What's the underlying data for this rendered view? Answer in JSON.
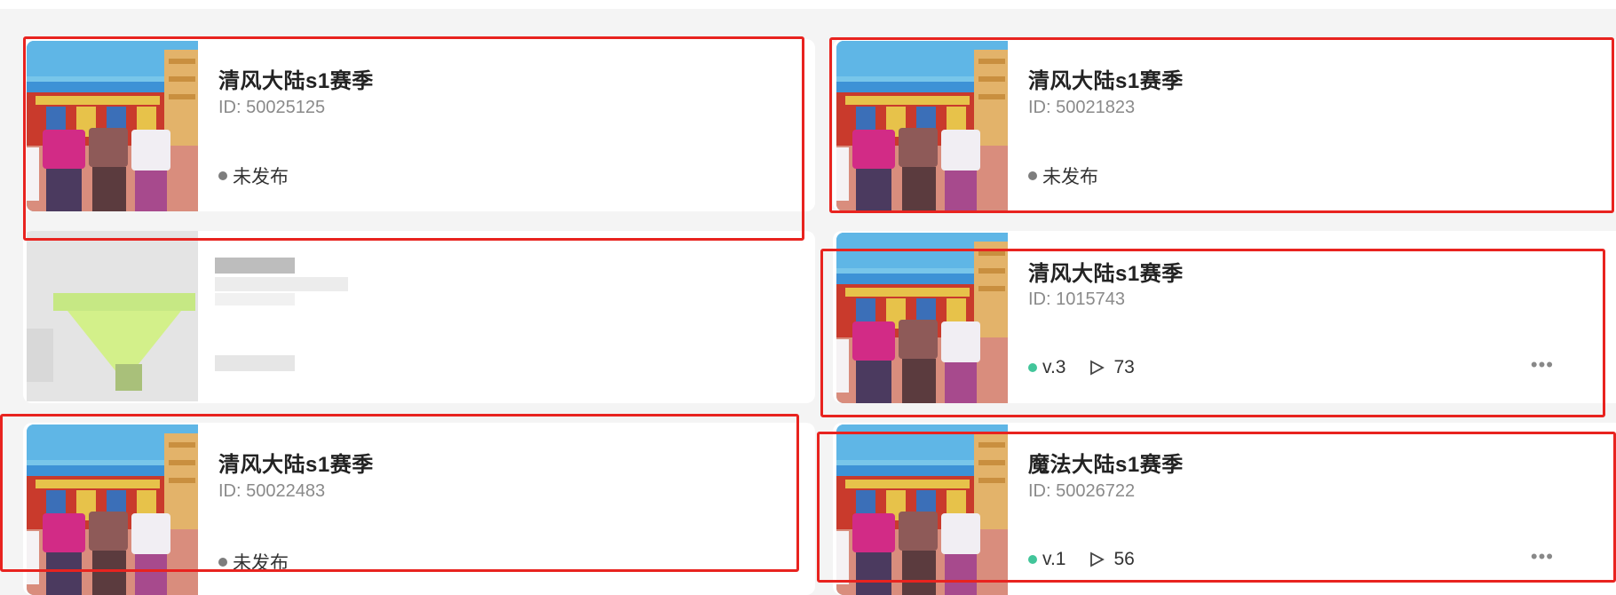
{
  "projects": [
    {
      "title": "清风大陆s1赛季",
      "id_text": "ID: 50025125",
      "status": "未发布"
    },
    {
      "title": "清风大陆s1赛季",
      "id_text": "ID: 50021823",
      "status": "未发布"
    },
    {
      "title": "清风大陆s1赛季",
      "id_text": "ID: 1015743",
      "version": "v.3",
      "plays": "73"
    },
    {
      "title": "清风大陆s1赛季",
      "id_text": "ID: 50022483",
      "status": "未发布"
    },
    {
      "title": "魔法大陆s1赛季",
      "id_text": "ID: 50026722",
      "version": "v.1",
      "plays": "56"
    }
  ],
  "icons": {
    "more": "more-dots-icon",
    "play": "play-icon",
    "status_dot_unpublished": "#7d7d7d",
    "status_dot_published": "#42c59a"
  },
  "highlight_color": "#e8231f"
}
